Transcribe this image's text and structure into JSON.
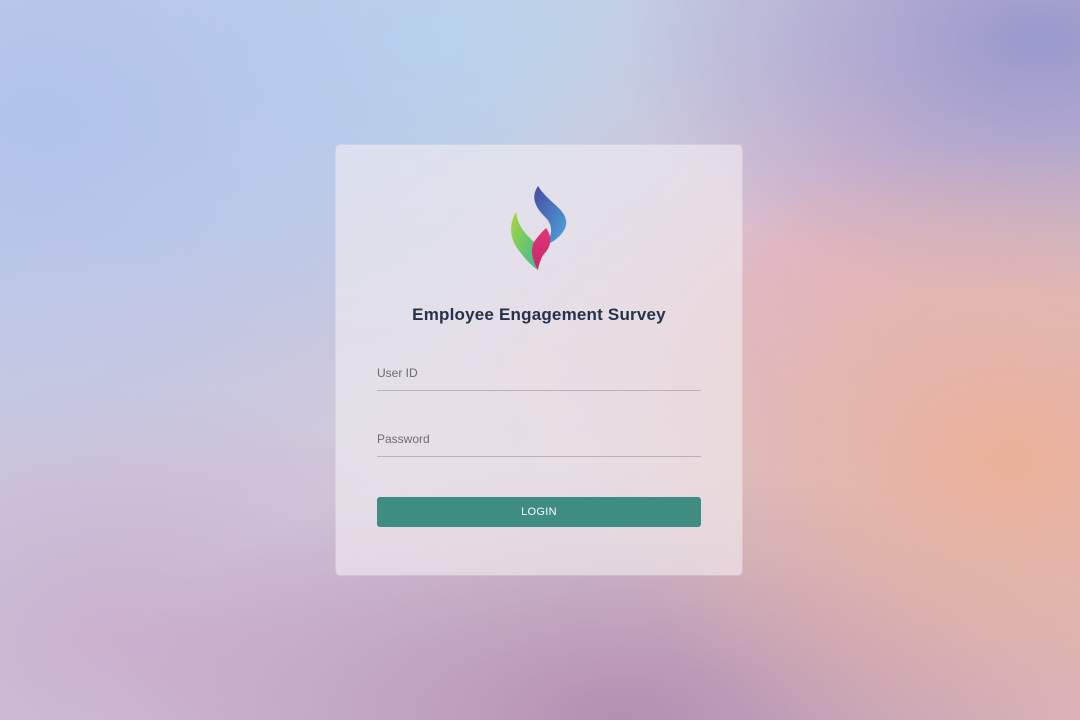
{
  "login": {
    "title": "Employee Engagement Survey",
    "user_id_placeholder": "User ID",
    "password_placeholder": "Password",
    "login_label": "LOGIN"
  },
  "logo": {
    "icon": "flame-leaf-logo-icon",
    "colors": [
      "#5a60b0",
      "#4aa8e0",
      "#e0357a",
      "#8ccf3c",
      "#3cb89a"
    ]
  },
  "colors": {
    "button": "#3e8c82",
    "title": "#24324a"
  }
}
